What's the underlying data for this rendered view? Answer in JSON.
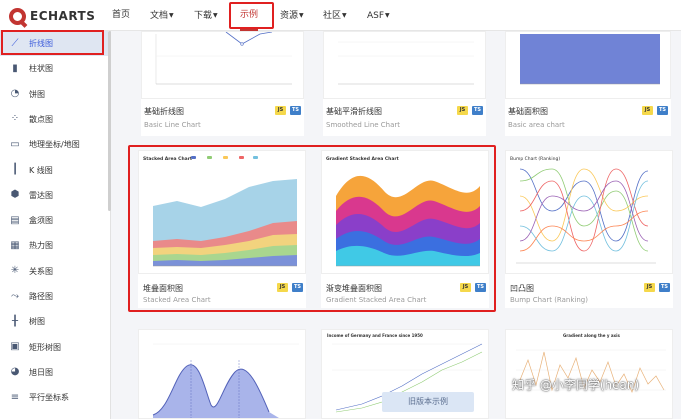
{
  "brand": {
    "name": "ECHARTS"
  },
  "nav": {
    "home": "首页",
    "docs": "文档",
    "download": "下载",
    "examples": "示例",
    "resources": "资源",
    "community": "社区",
    "asf": "ASF"
  },
  "sidebar": {
    "items": [
      {
        "label": "折线图",
        "icon": "line-chart-icon"
      },
      {
        "label": "柱状图",
        "icon": "bar-chart-icon"
      },
      {
        "label": "饼图",
        "icon": "pie-chart-icon"
      },
      {
        "label": "散点图",
        "icon": "scatter-icon"
      },
      {
        "label": "地理坐标/地图",
        "icon": "map-icon"
      },
      {
        "label": "K 线图",
        "icon": "candlestick-icon"
      },
      {
        "label": "雷达图",
        "icon": "radar-icon"
      },
      {
        "label": "盒须图",
        "icon": "boxplot-icon"
      },
      {
        "label": "热力图",
        "icon": "heatmap-icon"
      },
      {
        "label": "关系图",
        "icon": "graph-icon"
      },
      {
        "label": "路径图",
        "icon": "lines-icon"
      },
      {
        "label": "树图",
        "icon": "tree-icon"
      },
      {
        "label": "矩形树图",
        "icon": "treemap-icon"
      },
      {
        "label": "旭日图",
        "icon": "sunburst-icon"
      },
      {
        "label": "平行坐标系",
        "icon": "parallel-icon"
      }
    ]
  },
  "cards": [
    {
      "title": "基础折线图",
      "subtitle": "Basic Line Chart",
      "js": "JS",
      "ts": "TS"
    },
    {
      "title": "基础平滑折线图",
      "subtitle": "Smoothed Line Chart",
      "js": "JS",
      "ts": "TS"
    },
    {
      "title": "基础面积图",
      "subtitle": "Basic area chart",
      "js": "JS",
      "ts": "TS"
    },
    {
      "title": "堆叠面积图",
      "subtitle": "Stacked Area Chart",
      "js": "JS",
      "ts": "TS",
      "thumb_title": "Stacked Area Chart"
    },
    {
      "title": "渐变堆叠面积图",
      "subtitle": "Gradient Stacked Area Chart",
      "js": "JS",
      "ts": "TS",
      "thumb_title": "Gradient Stacked Area Chart"
    },
    {
      "title": "凹凸图",
      "subtitle": "Bump Chart (Ranking)",
      "js": "JS",
      "ts": "TS",
      "thumb_title": "Bump Chart (Ranking)"
    },
    {
      "thumb_title": ""
    },
    {
      "thumb_title": "Income of Germany and France since 1950"
    },
    {
      "thumb_title": "Gradient along the y axis"
    }
  ],
  "old_version_button": "旧版本示例",
  "watermark": "知乎 @小李同学(hean)",
  "colors": {
    "accent": "#c23531",
    "highlight_box": "#e02020",
    "sidebar_active_bg": "#dfe6f2",
    "link_blue": "#3b5bdb"
  }
}
